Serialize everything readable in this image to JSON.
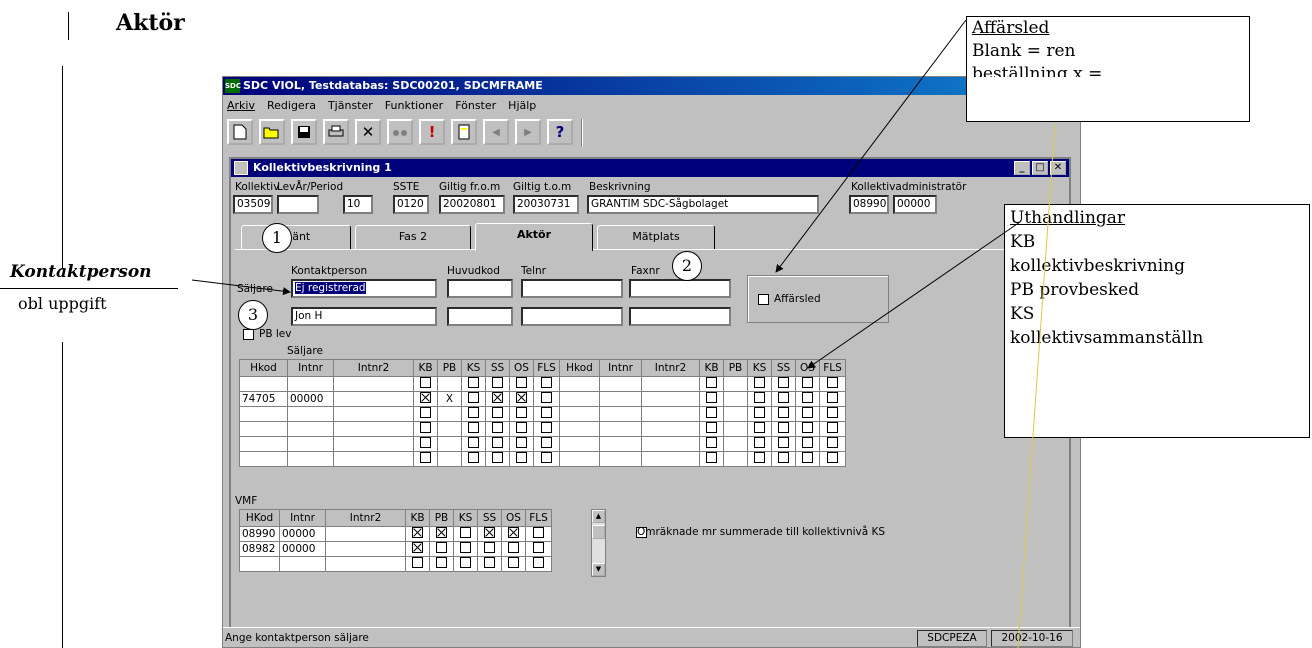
{
  "page": {
    "heading": "Aktör"
  },
  "app": {
    "title": "SDC VIOL, Testdatabas: SDC00201, SDCMFRAME",
    "icon_label": "SDC",
    "menu": [
      "Arkiv",
      "Redigera",
      "Tjänster",
      "Funktioner",
      "Fönster",
      "Hjälp"
    ],
    "toolbar": [
      "new-document-icon",
      "open-folder-icon",
      "save-icon",
      "print-icon",
      "delete-icon",
      "find-icon",
      "alert-icon",
      "copy-icon",
      "prev-icon",
      "next-icon",
      "help-icon"
    ],
    "toolbar_glyphs": {
      "alert": "!",
      "help": "?",
      "delete": "✕",
      "prev": "◀",
      "next": "▶"
    }
  },
  "window": {
    "title": "Kollektivbeskrivning 1",
    "buttons": [
      "_",
      "□",
      "✕"
    ]
  },
  "header_fields": {
    "kollektiv": {
      "label": "Kollektiv",
      "value": "03509"
    },
    "levar_period": {
      "label": "LevÅr/Period",
      "value1": "",
      "value2": "10"
    },
    "sste": {
      "label": "SSTE",
      "value": "0120"
    },
    "giltig_from": {
      "label": "Giltig fr.o.m",
      "value": "20020801"
    },
    "giltig_tom": {
      "label": "Giltig t.o.m",
      "value": "20030731"
    },
    "beskrivning": {
      "label": "Beskrivning",
      "value": "GRANTIM SDC-Sågbolaget"
    },
    "admin": {
      "label": "Kollektivadministratör",
      "value1": "08990",
      "value2": "00000"
    }
  },
  "tabs": [
    {
      "label": "...änt",
      "active": false
    },
    {
      "label": "Fas 2",
      "active": false
    },
    {
      "label": "Aktör",
      "active": true
    },
    {
      "label": "Mätplats",
      "active": false
    }
  ],
  "contact": {
    "col_kontaktperson": "Kontaktperson",
    "col_huvudkod": "Huvudkod",
    "col_telnr": "Telnr",
    "col_faxnr": "Faxnr",
    "row1_label": "Säljare",
    "row1_value": "Ej registrerad",
    "row2_label": "...",
    "row2_value": "Jon H",
    "affarsled_label": "Affärsled",
    "pb_lev_label": "PB lev"
  },
  "seller_grid": {
    "group_label": "Säljare",
    "columns_left": [
      "Hkod",
      "Intnr",
      "Intnr2",
      "KB",
      "PB",
      "KS",
      "SS",
      "OS",
      "FLS"
    ],
    "columns_right": [
      "Hkod",
      "Intnr",
      "Intnr2",
      "KB",
      "PB",
      "KS",
      "SS",
      "OS",
      "FLS"
    ],
    "rows": [
      {
        "hkod": "",
        "intnr": "",
        "intnr2": "",
        "kb": "box",
        "pb": "",
        "ks": "box",
        "ss": "box",
        "os": "box",
        "fls": "box"
      },
      {
        "hkod": "74705",
        "intnr": "00000",
        "intnr2": "",
        "kb": "checked",
        "pb": "X",
        "ks": "box",
        "ss": "checked",
        "os": "checked",
        "fls": "box"
      },
      {
        "hkod": "",
        "intnr": "",
        "intnr2": "",
        "kb": "box",
        "pb": "",
        "ks": "box",
        "ss": "box",
        "os": "box",
        "fls": "box"
      },
      {
        "hkod": "",
        "intnr": "",
        "intnr2": "",
        "kb": "box",
        "pb": "",
        "ks": "box",
        "ss": "box",
        "os": "box",
        "fls": "box"
      },
      {
        "hkod": "",
        "intnr": "",
        "intnr2": "",
        "kb": "box",
        "pb": "",
        "ks": "box",
        "ss": "box",
        "os": "box",
        "fls": "box"
      },
      {
        "hkod": "",
        "intnr": "",
        "intnr2": "",
        "kb": "box",
        "pb": "",
        "ks": "box",
        "ss": "box",
        "os": "box",
        "fls": "box"
      }
    ]
  },
  "vmf_grid": {
    "group_label": "VMF",
    "columns": [
      "HKod",
      "Intnr",
      "Intnr2",
      "KB",
      "PB",
      "KS",
      "SS",
      "OS",
      "FLS"
    ],
    "rows": [
      {
        "hkod": "08990",
        "intnr": "00000",
        "kb": "checked",
        "pb": "checked",
        "ks": "box",
        "ss": "checked",
        "os": "checked",
        "fls": "box"
      },
      {
        "hkod": "08982",
        "intnr": "00000",
        "kb": "checked",
        "pb": "box",
        "ks": "box",
        "ss": "box",
        "os": "box",
        "fls": "box"
      },
      {
        "hkod": "",
        "intnr": "",
        "kb": "box",
        "pb": "box",
        "ks": "box",
        "ss": "box",
        "os": "box",
        "fls": "box"
      }
    ],
    "omraknade_label": "Omräknade mr summerade till kollektivnivå KS"
  },
  "status": {
    "message": "Ange kontaktperson säljare",
    "pane1": "SDCPEZA",
    "pane2": "2002-10-16"
  },
  "annotations": {
    "affarsled_title": "Affärsled",
    "affarsled_line1": "Blank = ren",
    "affarsled_line2": "beställning x =",
    "uthandlingar_title": "Uthandlingar",
    "uthandlingar_lines": [
      "KB",
      "kollektivbeskrivning",
      "PB provbesked",
      "KS",
      "kollektivsammanställn"
    ],
    "kontaktperson_label": "Kontaktperson",
    "obl_label": "obl uppgift",
    "circle1": "1",
    "circle2": "2",
    "circle3": "3"
  }
}
